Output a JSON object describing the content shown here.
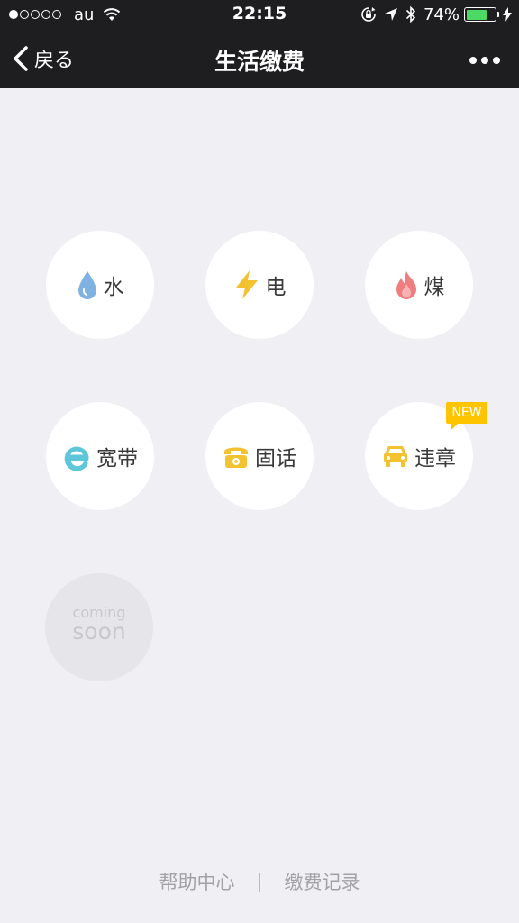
{
  "status_bar": {
    "carrier": "au",
    "time": "22:15",
    "battery_percent": "74%",
    "battery_level": 0.74,
    "battery_color": "#4cd964",
    "icons": [
      "signal-dots-icon",
      "wifi-icon",
      "orientation-lock-icon",
      "location-arrow-icon",
      "bluetooth-icon",
      "battery-icon",
      "charging-bolt-icon"
    ]
  },
  "nav": {
    "back_label": "戻る",
    "title": "生活缴费",
    "more_icon": "more-dots-icon"
  },
  "services": [
    {
      "label": "水",
      "icon": "water-drop-icon",
      "color": "#7fb2e3"
    },
    {
      "label": "电",
      "icon": "lightning-icon",
      "color": "#f2c230"
    },
    {
      "label": "煤",
      "icon": "flame-icon",
      "color": "#ef7d7d"
    },
    {
      "label": "宽带",
      "icon": "broadband-e-icon",
      "color": "#5ec6d9"
    },
    {
      "label": "固话",
      "icon": "telephone-icon",
      "color": "#f2c230"
    },
    {
      "label": "违章",
      "icon": "car-icon",
      "color": "#f2c230",
      "badge": "NEW"
    }
  ],
  "coming_soon": {
    "line1": "coming",
    "line2": "soon"
  },
  "footer": {
    "help": "帮助中心",
    "divider": "|",
    "records": "缴费记录"
  },
  "colors": {
    "header_bg": "#1e1e20",
    "page_bg": "#efeff4",
    "badge": "#ffc400"
  }
}
